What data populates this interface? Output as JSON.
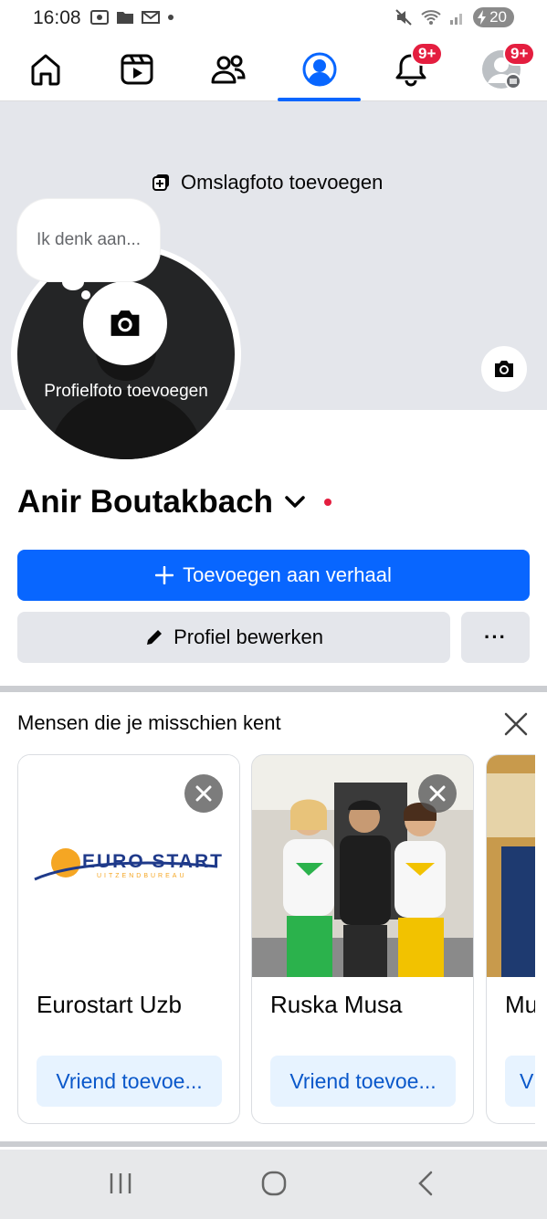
{
  "status_bar": {
    "time": "16:08",
    "battery": "20"
  },
  "top_nav": {
    "items": [
      {
        "name": "home",
        "icon": "home-icon"
      },
      {
        "name": "video",
        "icon": "video-icon"
      },
      {
        "name": "friends",
        "icon": "friends-icon"
      },
      {
        "name": "profile",
        "icon": "profile-icon",
        "active": true
      },
      {
        "name": "notifications",
        "icon": "bell-icon",
        "badge": "9+"
      },
      {
        "name": "menu",
        "icon": "menu-avatar-icon",
        "badge": "9+"
      }
    ],
    "accent": "#0866ff"
  },
  "cover": {
    "add_label": "Omslagfoto toevoegen"
  },
  "profile": {
    "thought_placeholder": "Ik denk aan...",
    "add_photo_label": "Profielfoto toevoegen",
    "name": "Anir Boutakbach"
  },
  "actions": {
    "add_story": "Toevoegen aan verhaal",
    "edit_profile": "Profiel bewerken",
    "more": "···"
  },
  "pymk": {
    "title": "Mensen die je misschien kent",
    "cards": [
      {
        "name": "Eurostart Uzb",
        "button": "Vriend toevoe...",
        "logo_text": "EURO START",
        "logo_subtext": "UITZENDBUREAU"
      },
      {
        "name": "Ruska Musa",
        "button": "Vriend toevoe..."
      },
      {
        "name": "Mu",
        "button": "V"
      }
    ]
  },
  "colors": {
    "primary": "#0866ff",
    "badge": "#e41e3f",
    "secondary_bg": "#e4e6eb"
  }
}
